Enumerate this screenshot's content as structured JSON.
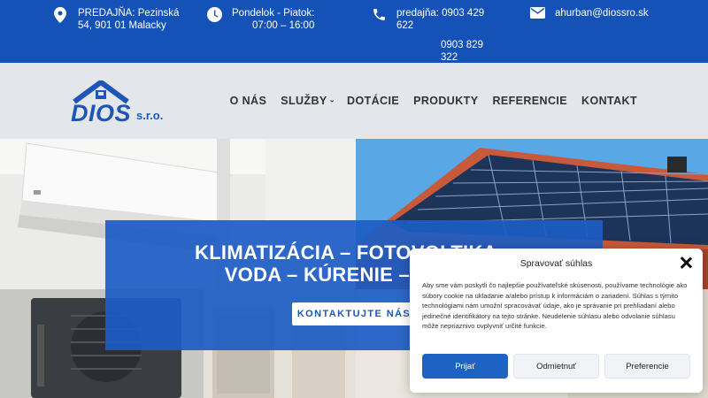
{
  "topbar": {
    "address": "PREDAJŇA: Pezinská\n54, 901 01 Malacky",
    "hours": "Pondelok - Piatok:\n07:00 – 16:00",
    "phone1": "predajňa: 0903 429\n622",
    "phone2": "0903 829\n322",
    "email": "ahurban@diossro.sk",
    "icons": [
      "location-pin-icon",
      "clock-icon",
      "phone-icon",
      "envelope-icon"
    ]
  },
  "header": {
    "logo_text": "DIOS",
    "logo_suffix": "s.r.o.",
    "nav": [
      {
        "label": "O NÁS"
      },
      {
        "label": "SLUŽBY",
        "chevron": "‹"
      },
      {
        "label": "DOTÁCIE"
      },
      {
        "label": "PRODUKTY"
      },
      {
        "label": "REFERENCIE"
      },
      {
        "label": "KONTAKT"
      }
    ]
  },
  "hero": {
    "title_line1": "KLIMATIZÁCIA – FOTOVOLTIKA – ",
    "title_line2": "VODA – KÚRENIE – PLYN – ",
    "cta": "KONTAKTUJTE NÁS"
  },
  "cookie": {
    "title": "Spravovať súhlas",
    "body": "Aby sme vám poskytli čo najlepšie používateľské skúsenosti, používame technológie ako súbory cookie na ukladanie a/alebo prístup k informáciám o zariadení. Súhlas s týmito technológiami nám umožní spracovávať údaje, ako je správanie pri prehliadaní alebo jedinečné identifikátory na tejto stránke. Neudelenie súhlasu alebo odvolanie súhlasu môže nepriaznivo ovplyvniť určité funkcie.",
    "accept": "Prijať",
    "deny": "Odmietnuť",
    "preferences": "Preferencie"
  },
  "colors": {
    "brand_blue": "#1552b8",
    "header_bg": "#e3e6ea",
    "hero_overlay": "#1c5cc4"
  }
}
